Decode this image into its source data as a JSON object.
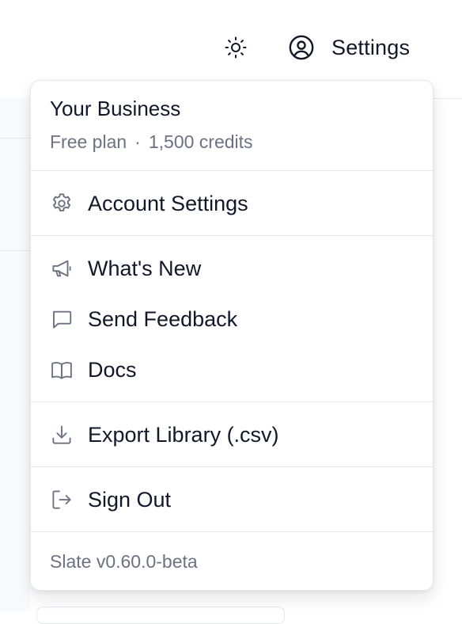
{
  "header": {
    "theme_icon": "sun-icon",
    "user_icon": "user-circle-icon",
    "settings_label": "Settings"
  },
  "menu": {
    "account": {
      "name": "Your Business",
      "plan": "Free plan",
      "separator": "·",
      "credits": "1,500 credits"
    },
    "items": [
      {
        "label": "Account Settings",
        "icon": "gear-icon"
      },
      {
        "label": "What's New",
        "icon": "megaphone-icon"
      },
      {
        "label": "Send Feedback",
        "icon": "chat-bubble-icon"
      },
      {
        "label": "Docs",
        "icon": "book-open-icon"
      },
      {
        "label": "Export Library (.csv)",
        "icon": "download-icon"
      },
      {
        "label": "Sign Out",
        "icon": "sign-out-icon"
      }
    ],
    "version": "Slate v0.60.0-beta"
  },
  "colors": {
    "text_primary": "#111827",
    "text_muted": "#6b7280",
    "icon": "#6b7280",
    "border": "#e5e7eb"
  }
}
